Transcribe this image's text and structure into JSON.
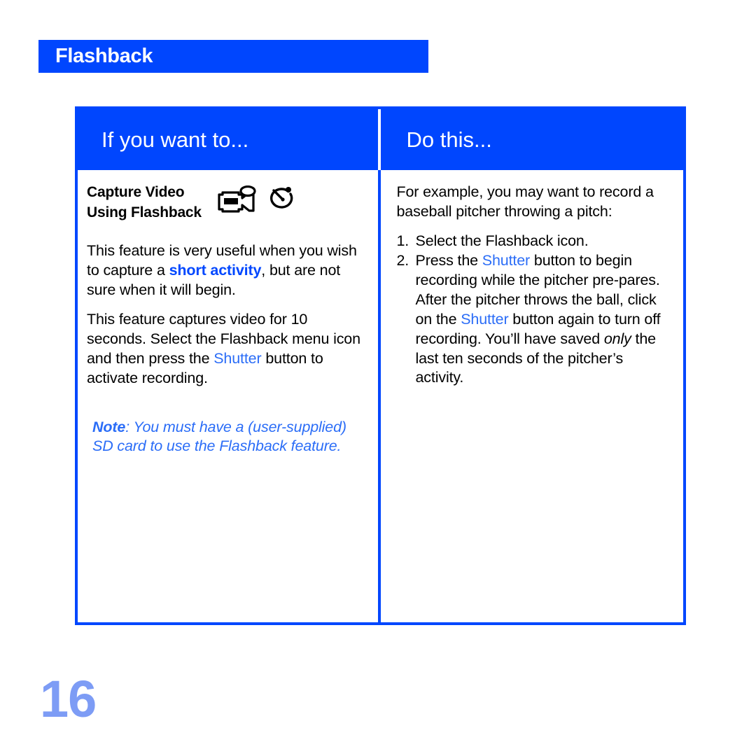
{
  "page": {
    "number": "16",
    "chapter_banner": {
      "title": "Flashback",
      "background_color": "#0046fe",
      "text_color": "#ffffff"
    }
  },
  "table": {
    "border_color": "#0046fe",
    "header_background": "#0046fe",
    "columns": [
      {
        "header": "If you want to..."
      },
      {
        "header": "Do this..."
      }
    ],
    "left_column": {
      "feature_title_line1": "Capture Video",
      "feature_title_line2": "Using Flashback",
      "icons": [
        {
          "name": "camcorder-icon",
          "label": "Camcorder"
        },
        {
          "name": "stopwatch-icon",
          "label": "Stopwatch"
        }
      ],
      "paragraph_1": {
        "part_1": "This feature is very useful when you wish to capture a ",
        "highlight": "short activity",
        "part_2": ", but are not sure when it will begin."
      },
      "paragraph_2": {
        "part_1": "This feature captures video for 10 seconds. Select the Flashback menu icon and then press the ",
        "highlight": "Shutter",
        "part_2": " button to activate recording."
      },
      "note": {
        "label": "Note",
        "text": ": You must have a (user-supplied) SD card to use the Flashback feature.",
        "color": "#2b6df7"
      }
    },
    "right_column": {
      "intro": "For example, you may want to record a baseball pitcher throwing a pitch:",
      "steps": [
        {
          "number": "1.",
          "part_1": "Select the Flashback icon.",
          "highlight": "",
          "part_2": ""
        },
        {
          "number": "2.",
          "part_1": "Press the ",
          "highlight": "Shutter",
          "part_2": " button to begin recording while the pitcher pre-pares. After the pitcher throws the ball, click on the ",
          "highlight_2": "Shutter",
          "part_3": " button again to turn off recording. You’ll have saved ",
          "emphasis": "only",
          "part_4": " the last ten seconds of the pitcher’s activity."
        }
      ]
    }
  },
  "colors": {
    "brand_blue": "#0046fe",
    "link_blue": "#2b6df7",
    "keyword_blue": "#0047ff",
    "page_number_blue": "#7d9cf5",
    "body_text": "#000000"
  }
}
